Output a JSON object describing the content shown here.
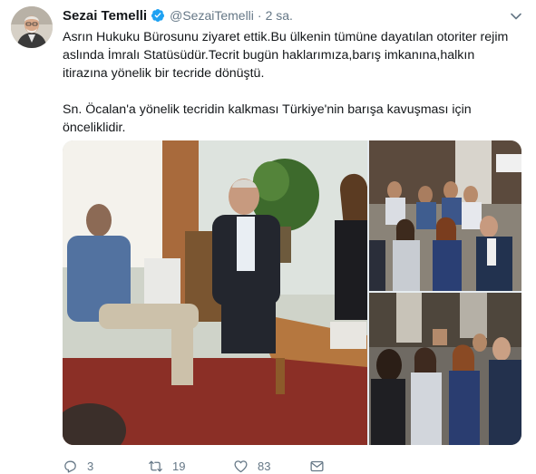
{
  "tweet": {
    "name": "Sezai Temelli",
    "handle": "@SezaiTemelli",
    "separator": "·",
    "time": "2 sa.",
    "paragraph1": "Asrın Hukuku Bürosunu ziyaret ettik.Bu ülkenin tümüne dayatılan otoriter rejim aslında İmralı Statüsüdür.Tecrit bugün haklarımıza,barış imkanına,halkın itirazına yönelik bir tecride dönüştü.",
    "paragraph2": "Sn. Öcalan'a yönelik tecridin kalkması Türkiye'nin barışa kavuşması için önceliklidir."
  },
  "actions": {
    "reply_count": "3",
    "retweet_count": "19",
    "like_count": "83"
  },
  "icons": {
    "verified": "verified-badge-icon",
    "caret": "chevron-down-icon",
    "reply": "reply-icon",
    "retweet": "retweet-icon",
    "like": "heart-icon",
    "dm": "envelope-icon"
  },
  "colors": {
    "verified_blue": "#1da1f2",
    "muted": "#657786",
    "text": "#14171a"
  }
}
